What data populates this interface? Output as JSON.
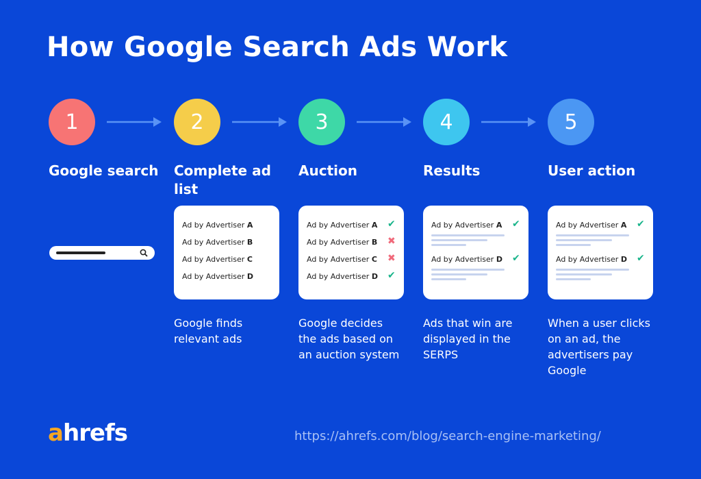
{
  "title": "How Google Search Ads Work",
  "colors": {
    "background": "#0a47d8",
    "step1": "#f77474",
    "step2": "#f5cd4a",
    "step3": "#3ed8a7",
    "step4": "#3ec6ef",
    "step5": "#4b97f3",
    "arrow": "#5a93f5",
    "check": "#19b48a",
    "cross": "#f0697a",
    "logo_accent": "#f5a623"
  },
  "steps": [
    {
      "number": "1",
      "label": "Google search",
      "description": ""
    },
    {
      "number": "2",
      "label": "Complete ad list",
      "description": "Google finds relevant ads"
    },
    {
      "number": "3",
      "label": "Auction",
      "description": "Google decides the ads based on an auction system"
    },
    {
      "number": "4",
      "label": "Results",
      "description": "Ads that win are displayed in the SERPS"
    },
    {
      "number": "5",
      "label": "User action",
      "description": "When a user clicks on an ad, the advertisers pay Google"
    }
  ],
  "ad_prefix": "Ad by Advertiser",
  "cards": {
    "list": [
      {
        "adv": "A"
      },
      {
        "adv": "B"
      },
      {
        "adv": "C"
      },
      {
        "adv": "D"
      }
    ],
    "auction": [
      {
        "adv": "A",
        "mark": "✔"
      },
      {
        "adv": "B",
        "mark": "✖"
      },
      {
        "adv": "C",
        "mark": "✖"
      },
      {
        "adv": "D",
        "mark": "✔"
      }
    ],
    "results": [
      {
        "adv": "A",
        "mark": "✔"
      },
      {
        "adv": "D",
        "mark": "✔"
      }
    ],
    "action": [
      {
        "adv": "A",
        "mark": "✔"
      },
      {
        "adv": "D",
        "mark": "✔"
      }
    ]
  },
  "icons": {
    "search": "🔍"
  },
  "footer": {
    "logo_a": "a",
    "logo_rest": "hrefs",
    "url": "https://ahrefs.com/blog/search-engine-marketing/"
  }
}
